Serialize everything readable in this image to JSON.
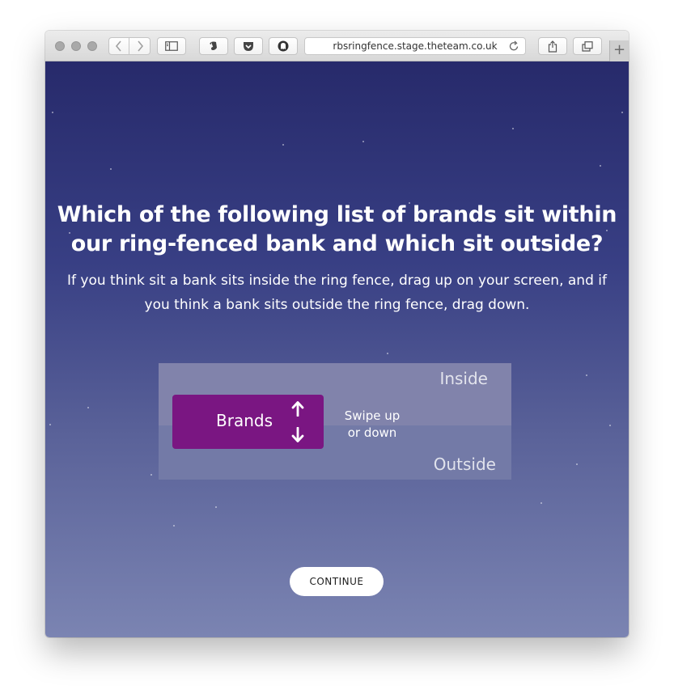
{
  "browser": {
    "url": "rbsringfence.stage.theteam.co.uk",
    "new_tab_label": "+"
  },
  "page": {
    "heading_line1": "Which of the following list of brands sit within",
    "heading_line2": "our ring-fenced bank and which sit outside?",
    "instruction_line1": "If you think sit a bank sits inside the ring fence, drag up on your screen, and if",
    "instruction_line2": "you think a bank sits outside the ring fence, drag down."
  },
  "demo": {
    "inside_label": "Inside",
    "outside_label": "Outside",
    "card_label": "Brands",
    "hint_line1": "Swipe up",
    "hint_line2": "or down"
  },
  "continue_label": "CONTINUE",
  "colors": {
    "background_top": "#272a6b",
    "background_bottom": "#7b84b2",
    "card": "#7a1682",
    "button": "#ffffff"
  }
}
